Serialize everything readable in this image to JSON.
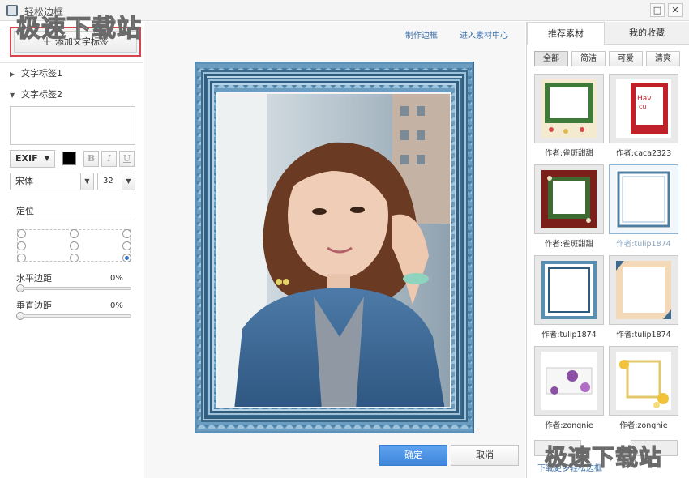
{
  "window": {
    "title": "轻松边框",
    "minimize_label": "□",
    "close_label": "✕"
  },
  "watermark": "极速下载站",
  "left_panel": {
    "add_button": {
      "icon": "+",
      "label": "添加文字标签"
    },
    "tags": [
      {
        "label": "文字标签1",
        "expanded": false,
        "arrow": "▶"
      },
      {
        "label": "文字标签2",
        "expanded": true,
        "arrow": "▼"
      }
    ],
    "text_value": "",
    "format_select": "EXIF",
    "text_color": "#000000",
    "bold_label": "B",
    "italic_label": "I",
    "underline_label": "U",
    "font_family": "宋体",
    "font_size": "32",
    "position_label": "定位",
    "position_selected": "bottom-right",
    "horizontal_margin": {
      "label": "水平边距",
      "value_text": "0%",
      "value": 0
    },
    "vertical_margin": {
      "label": "垂直边距",
      "value_text": "0%",
      "value": 0
    }
  },
  "center": {
    "links": {
      "make_frame": "制作边框",
      "material_center": "进入素材中心"
    },
    "ok_label": "确定",
    "cancel_label": "取消"
  },
  "right_panel": {
    "tabs": [
      {
        "label": "推荐素材",
        "active": true
      },
      {
        "label": "我的收藏",
        "active": false
      }
    ],
    "filters": [
      {
        "label": "全部",
        "active": true
      },
      {
        "label": "简洁"
      },
      {
        "label": "可爱"
      },
      {
        "label": "清爽"
      }
    ],
    "thumbnails": [
      {
        "author": "作者:雀斑甜甜",
        "style": "green-floral"
      },
      {
        "author": "作者:caca2323",
        "style": "red-cute"
      },
      {
        "author": "作者:雀斑甜甜",
        "style": "dark-red"
      },
      {
        "author": "作者:tulip1874",
        "style": "blue-simple",
        "selected": true
      },
      {
        "author": "作者:tulip1874",
        "style": "blue-lines"
      },
      {
        "author": "作者:tulip1874",
        "style": "peach"
      },
      {
        "author": "作者:zongnie",
        "style": "purple-flowers"
      },
      {
        "author": "作者:zongnie",
        "style": "yellow-flowers"
      }
    ],
    "more_link": "下载更多轻松边框"
  }
}
